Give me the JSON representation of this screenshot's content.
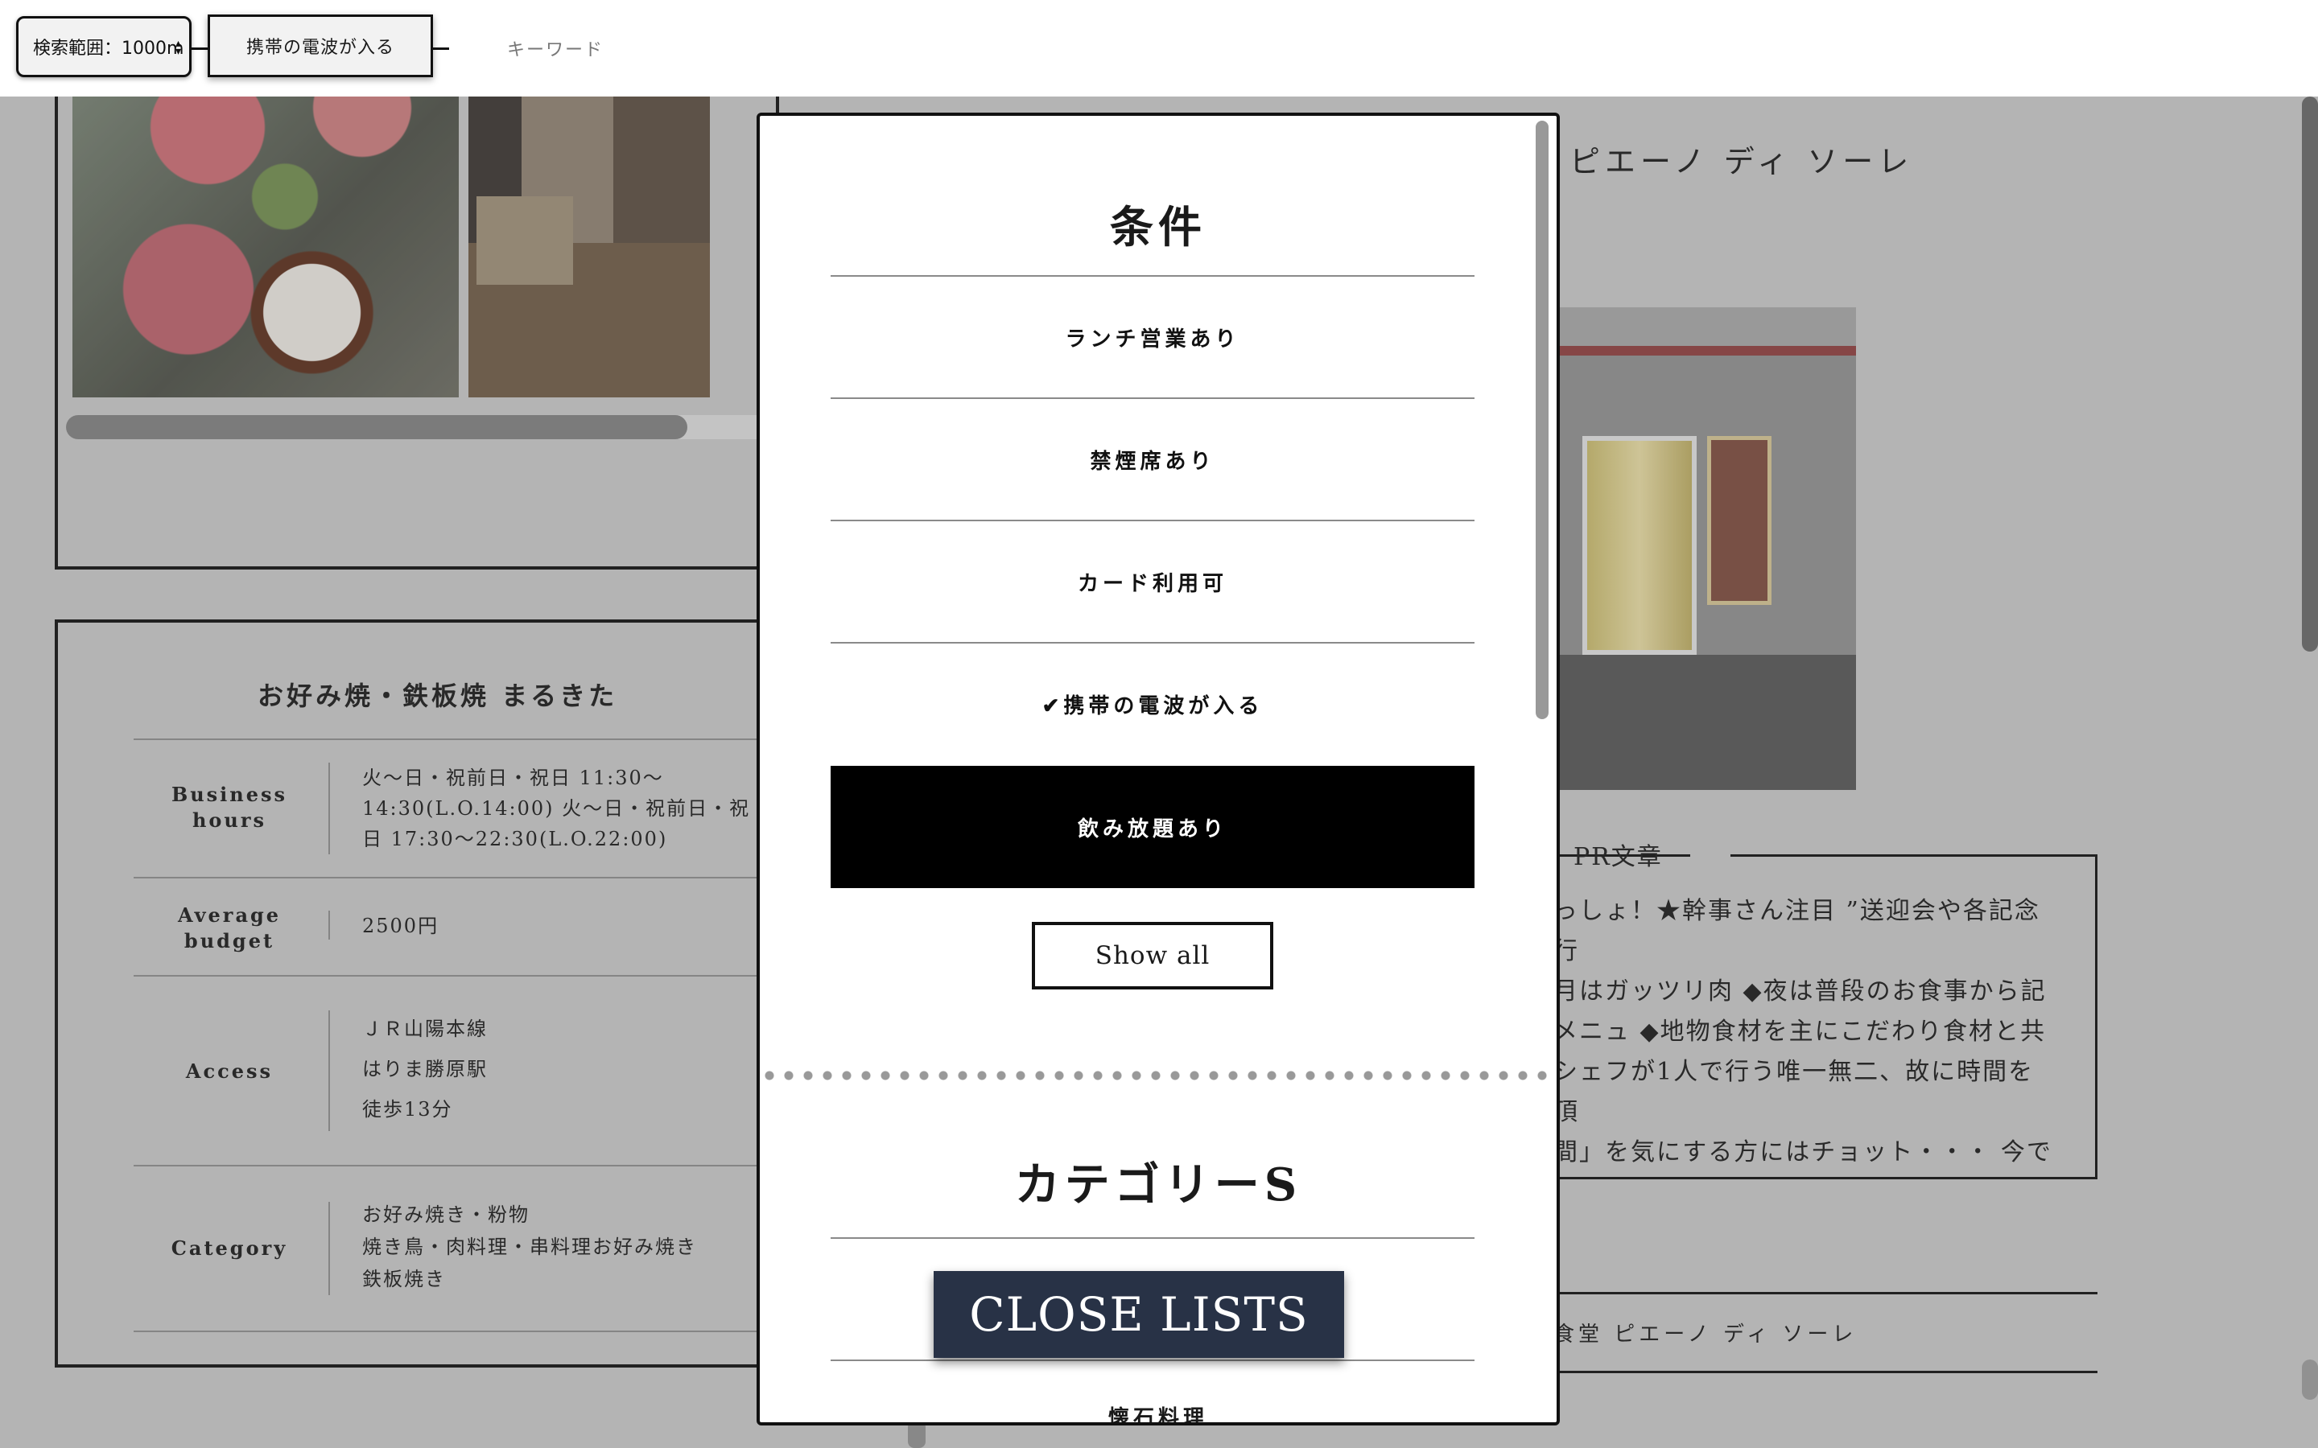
{
  "topbar": {
    "range_select": "検索範囲：1000m",
    "range_arrows": "▴\n▾",
    "active_filter": "携帯の電波が入る",
    "keyword_placeholder": "キーワード"
  },
  "left_card": {
    "shop_name": "お好み焼・鉄板焼 まるきた",
    "rows": [
      {
        "label": "Business hours",
        "value": "火〜日・祝前日・祝日 11:30〜14:30(L.O.14:00) 火〜日・祝前日・祝日 17:30〜22:30(L.O.22:00)"
      },
      {
        "label": "Average budget",
        "value": "2500円"
      },
      {
        "label": "Access",
        "value_lines": [
          "ＪＲ山陽本線",
          "はりま勝原駅",
          "徒歩13分"
        ]
      },
      {
        "label": "Category",
        "value_lines": [
          "お好み焼き・粉物",
          "焼き鳥・肉料理・串料理お好み焼き",
          "鉄板焼き"
        ]
      }
    ]
  },
  "right_card": {
    "title": "ピエーノ ディ ソーレ",
    "pr_label": "PR文章",
    "pr_lines": [
      "っしょ！★幹事さん注目 ”送迎会や各記念行",
      "月はガッツリ肉 ◆夜は普段のお食事から記",
      "メニュ ◆地物食材を主にこだわり食材と共",
      "シェフが1人で行う唯一無二、故に時間を頂",
      "間」を気にする方にはチョット・・・ 今で"
    ],
    "shop_name_bottom": "食堂 ピエーノ ディ ソーレ"
  },
  "modal": {
    "conditions_heading": "条件",
    "conditions": [
      {
        "label": "ランチ営業あり",
        "active": false
      },
      {
        "label": "禁煙席あり",
        "active": false
      },
      {
        "label": "カード利用可",
        "active": false
      },
      {
        "label": "✔携帯の電波が入る",
        "active": false
      },
      {
        "label": "飲み放題あり",
        "active": true
      }
    ],
    "show_all": "Show all",
    "categories_heading": "カテゴリーS",
    "partial_item": "懐石料理"
  },
  "close_button": "CLOSE LISTS",
  "colors": {
    "close_button_bg": "#283246",
    "active_option_bg": "#000000",
    "backdrop": "#c4c4c4"
  }
}
